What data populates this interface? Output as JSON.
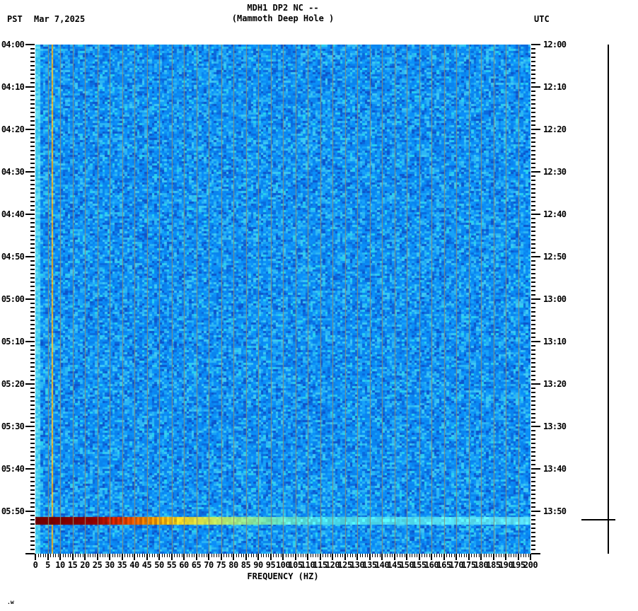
{
  "header": {
    "tz_left": "PST",
    "date": "Mar 7,2025",
    "title_line1": "MDH1 DP2 NC --",
    "title_line2": "(Mammoth Deep Hole )",
    "tz_right": "UTC"
  },
  "footer_note": ".w",
  "chart_data": {
    "type": "heatmap",
    "subtype": "seismic-spectrogram",
    "title": "MDH1 DP2 NC --",
    "subtitle": "(Mammoth Deep Hole )",
    "station": "MDH1 DP2 NC",
    "station_name": "Mammoth Deep Hole",
    "date": "Mar 7,2025",
    "xlabel": "FREQUENCY (HZ)",
    "x_range_hz": [
      0,
      200
    ],
    "x_major_tick_step_hz": 5,
    "x_minor_tick_step_hz": 1,
    "x_labels": [
      "0",
      "5",
      "10",
      "15",
      "20",
      "25",
      "30",
      "35",
      "40",
      "45",
      "50",
      "55",
      "60",
      "65",
      "70",
      "75",
      "80",
      "85",
      "90",
      "95",
      "100",
      "105",
      "110",
      "115",
      "120",
      "125",
      "130",
      "135",
      "140",
      "145",
      "150",
      "155",
      "160",
      "165",
      "170",
      "175",
      "180",
      "185",
      "190",
      "195",
      "200"
    ],
    "y_left_axis": {
      "timezone": "PST",
      "start": "04:00",
      "end": "06:00",
      "major_tick_minutes": 10,
      "minor_tick_minutes": 1,
      "labels": [
        "04:00",
        "04:10",
        "04:20",
        "04:30",
        "04:40",
        "04:50",
        "05:00",
        "05:10",
        "05:20",
        "05:30",
        "05:40",
        "05:50"
      ]
    },
    "y_right_axis": {
      "timezone": "UTC",
      "start": "12:00",
      "end": "14:00",
      "major_tick_minutes": 10,
      "minor_tick_minutes": 1,
      "labels": [
        "12:00",
        "12:10",
        "12:20",
        "12:30",
        "12:40",
        "12:50",
        "13:00",
        "13:10",
        "13:20",
        "13:30",
        "13:40",
        "13:50"
      ]
    },
    "legend_position": "none",
    "grid": {
      "vertical_lines_every_hz": 5,
      "color": "#8c8c74"
    },
    "background_noise": {
      "description": "blocky blue background noise",
      "palette": [
        "#0a84ee",
        "#0b8ff8",
        "#18a2f8",
        "#2cb6f4",
        "#3ec8f4",
        "#0a6ade",
        "#0c55cc",
        "#28d2f0"
      ]
    },
    "features": [
      {
        "name": "broadband-event",
        "description": "earthquake signal: horizontal band across all frequencies, dark red at low frequency grading through red, orange, yellow, green to cyan at high frequency",
        "time_pst": "05:52",
        "time_utc": "13:52",
        "freq_span_hz": [
          0,
          200
        ],
        "color_stops_hz": {
          "0": "#6e0000",
          "24": "#8f0000",
          "34": "#d62c00",
          "46": "#f88a00",
          "58": "#f2d020",
          "74": "#bce766",
          "94": "#6fdfb2",
          "115": "#46d6e8",
          "200": "#58d8f0"
        }
      },
      {
        "name": "narrowband-line",
        "description": "persistent yellow-orange spectral line",
        "freq_hz": 6.5,
        "color": "#e8a820"
      },
      {
        "name": "low-frequency-edge",
        "description": "brighter cyan energy at lowest frequencies",
        "freq_span_hz": [
          0,
          2
        ]
      }
    ],
    "side_trace": {
      "description": "vertical seismogram amplitude trace at right margin, flat line with spike at event time",
      "spike_time_pst": "05:52",
      "spike_time_utc": "13:52"
    }
  }
}
